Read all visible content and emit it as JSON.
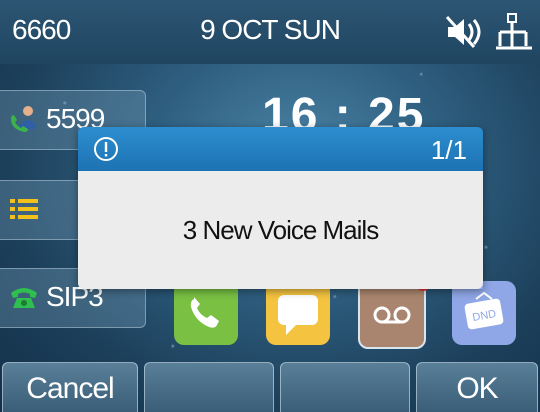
{
  "status_bar": {
    "account": "6660",
    "date": "9 OCT SUN",
    "icons": [
      "speaker-muted-icon",
      "network-icon"
    ]
  },
  "line_keys": [
    {
      "label": "5599",
      "icon": "contact-phone-icon"
    },
    {
      "label": "",
      "icon": "menu-list-icon"
    },
    {
      "label": "SIP3",
      "icon": "telephone-icon"
    }
  ],
  "clock": {
    "time": "16 : 25"
  },
  "apps": [
    {
      "name": "phone-app-icon",
      "color": "#79c043"
    },
    {
      "name": "messages-app-icon",
      "color": "#f4c33f"
    },
    {
      "name": "voicemail-app-icon",
      "color": "#a9856f",
      "badge": true
    },
    {
      "name": "dnd-app-icon",
      "color": "#8fa7e6",
      "label": "DND"
    }
  ],
  "dialog": {
    "counter": "1/1",
    "message": "3 New Voice Mails",
    "icon": "info-icon"
  },
  "softkeys": [
    "Cancel",
    "",
    "",
    "OK"
  ],
  "colors": {
    "dialog_header": "#1d72b3",
    "dialog_body": "#ececec",
    "badge": "#e5322d"
  }
}
